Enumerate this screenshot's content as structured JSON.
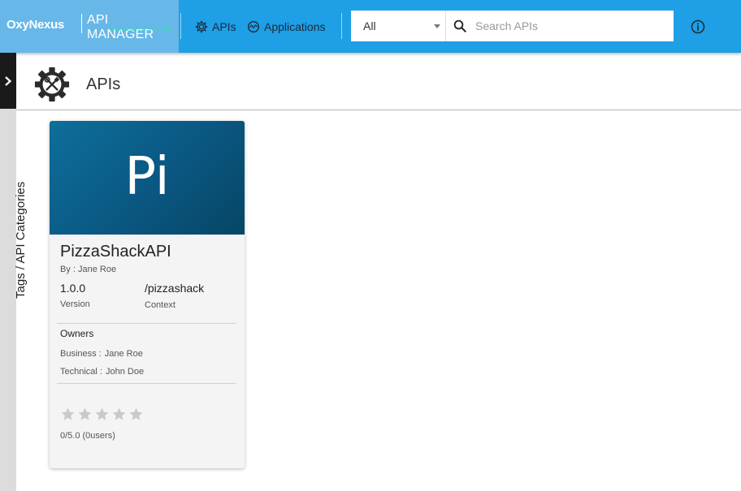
{
  "header": {
    "brand_name": "OxyNexus",
    "brand_title": "API MANAGER",
    "brand_subtitle": "DEVELOPER PORTAL",
    "nav": [
      {
        "label": "APIs",
        "icon": "gear-icon"
      },
      {
        "label": "Applications",
        "icon": "applications-icon"
      }
    ],
    "search": {
      "filter_value": "All",
      "placeholder": "Search APIs"
    },
    "info_icon": "info-icon"
  },
  "sidebar": {
    "toggle_icon": "chevron-right-icon",
    "label": "Tags / API Categories"
  },
  "page": {
    "title": "APIs",
    "icon": "gear-tools-icon"
  },
  "cards": [
    {
      "thumb_text": "Pi",
      "name": "PizzaShackAPI",
      "by": "By : Jane Roe",
      "version": "1.0.0",
      "version_label": "Version",
      "context": "/pizzashack",
      "context_label": "Context",
      "owners_title": "Owners",
      "business_label": "Business :",
      "business_value": "Jane Roe",
      "technical_label": "Technical :",
      "technical_value": "John Doe",
      "rating": 0,
      "rating_max": 5,
      "rating_text": "0/5.0 (0users)"
    }
  ],
  "colors": {
    "header_bg": "#1e9fe6",
    "brand_bg": "#67b7e9",
    "card_thumb": "#0a5782",
    "star_empty": "#c9c9c9"
  }
}
